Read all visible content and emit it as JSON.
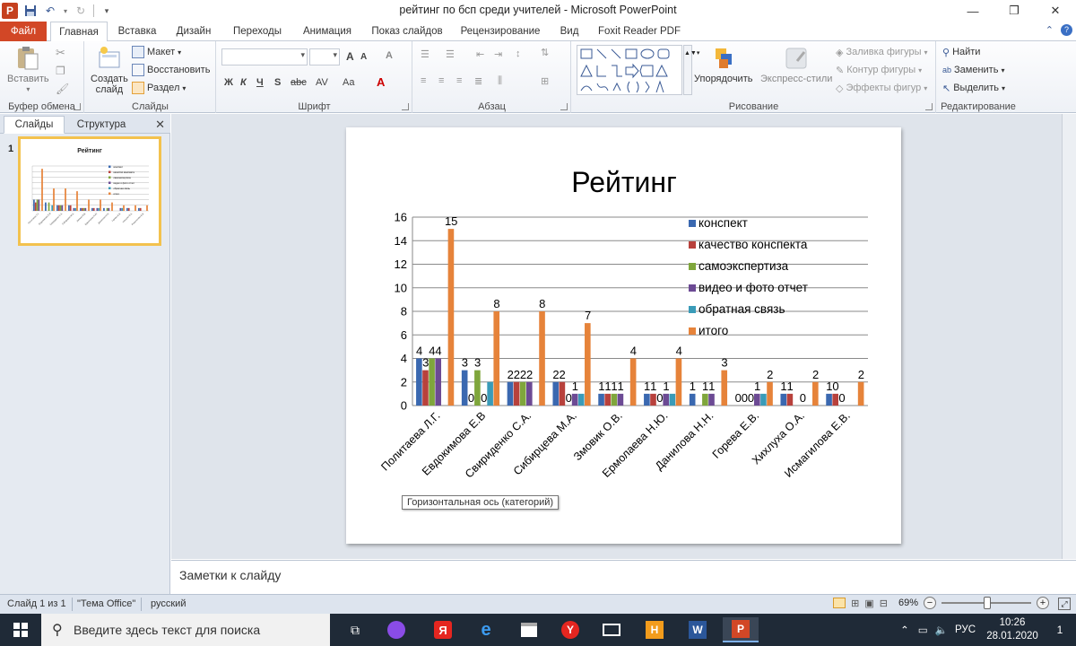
{
  "window": {
    "title": "рейтинг по бсп среди учителей - Microsoft PowerPoint",
    "app_icon": "P",
    "controls": [
      "minimize-icon",
      "restore-icon",
      "close-icon"
    ]
  },
  "ribbon_tabs": {
    "file": "Файл",
    "items": [
      "Главная",
      "Вставка",
      "Дизайн",
      "Переходы",
      "Анимация",
      "Показ слайдов",
      "Рецензирование",
      "Вид",
      "Foxit Reader PDF"
    ],
    "active": "Главная"
  },
  "ribbon": {
    "clipboard": {
      "label": "Буфер обмена",
      "paste": "Вставить"
    },
    "slides": {
      "label": "Слайды",
      "new_slide_1": "Создать",
      "new_slide_2": "слайд",
      "layout": "Макет",
      "reset": "Восстановить",
      "section": "Раздел"
    },
    "font": {
      "label": "Шрифт",
      "bold": "Ж",
      "italic": "К",
      "underline": "Ч",
      "shadow": "S",
      "strike": "abc",
      "spacing": "AV",
      "case": "Aa",
      "grow": "A",
      "shrink": "A",
      "clear": "A"
    },
    "paragraph": {
      "label": "Абзац"
    },
    "drawing": {
      "label": "Рисование",
      "arrange": "Упорядочить",
      "quick_styles": "Экспресс-стили",
      "fill": "Заливка фигуры",
      "outline": "Контур фигуры",
      "effects": "Эффекты фигур"
    },
    "editing": {
      "label": "Редактирование",
      "find": "Найти",
      "replace": "Заменить",
      "select": "Выделить"
    }
  },
  "left_pane": {
    "tab_slides": "Слайды",
    "tab_outline": "Структура",
    "slide_number": "1",
    "thumb_title": "Рейтинг"
  },
  "chart_data": {
    "type": "bar",
    "title": "Рейтинг",
    "xlabel": "",
    "ylabel": "",
    "ylim": [
      0,
      16
    ],
    "yticks": [
      0,
      2,
      4,
      6,
      8,
      10,
      12,
      14,
      16
    ],
    "grid": true,
    "legend_position": "top-right",
    "categories": [
      "Политаева Л.Г.",
      "Евдокимова Е.В",
      "Свириденко С.А.",
      "Сибирцева М.А.",
      "Змовик О.В.",
      "Ермолаева Н.Ю.",
      "Данилова Н.Н.",
      "Горева Е.В.",
      "Хихлуха О.А.",
      "Исмагилова Е.В."
    ],
    "series": [
      {
        "name": "конспект",
        "color": "#3a68b0",
        "values": [
          4,
          3,
          2,
          2,
          1,
          1,
          1,
          0,
          1,
          1
        ]
      },
      {
        "name": "качество конспекта",
        "color": "#b8413c",
        "values": [
          3,
          0,
          2,
          2,
          1,
          1,
          0,
          0,
          1,
          1
        ]
      },
      {
        "name": "самоэкспертиза",
        "color": "#7fa63c",
        "values": [
          4,
          3,
          2,
          0,
          1,
          0,
          1,
          0,
          0,
          0
        ]
      },
      {
        "name": "видео и фото отчет",
        "color": "#6c4a94",
        "values": [
          4,
          0,
          2,
          1,
          1,
          1,
          1,
          1,
          0,
          0
        ]
      },
      {
        "name": "обратная связь",
        "color": "#3a9bb8",
        "values": [
          0,
          2,
          0,
          1,
          0,
          1,
          0,
          1,
          0,
          0
        ]
      },
      {
        "name": "итого",
        "color": "#e6833a",
        "values": [
          15,
          8,
          8,
          7,
          4,
          4,
          3,
          2,
          2,
          2
        ]
      }
    ],
    "data_labels": [
      [
        "4",
        "3",
        "2",
        "2",
        "1",
        "1",
        "1",
        "0",
        "1",
        "1"
      ],
      [
        "3",
        "0",
        "2",
        "2",
        "1",
        "1",
        "",
        "0",
        "1",
        "0"
      ],
      [
        "4",
        "3",
        "2",
        "0",
        "1",
        "0",
        "1",
        "0",
        "",
        "0"
      ],
      [
        "4",
        "0",
        "2",
        "1",
        "1",
        "1",
        "1",
        "1",
        "0",
        ""
      ],
      [
        "",
        "",
        "",
        "",
        "",
        "",
        "",
        "",
        "",
        ""
      ],
      [
        "15",
        "8",
        "8",
        "7",
        "4",
        "4",
        "3",
        "2",
        "2",
        "2"
      ]
    ]
  },
  "tooltip": "Горизонтальная ось (категорий)",
  "notes": {
    "placeholder": "Заметки к слайду"
  },
  "statusbar": {
    "slide": "Слайд 1 из 1",
    "theme": "\"Тема Office\"",
    "language": "русский",
    "zoom": "69%",
    "zoom_level": 0.69
  },
  "taskbar": {
    "search_placeholder": "Введите здесь текст для поиска",
    "lang": "РУС",
    "time": "10:26",
    "date": "28.01.2020",
    "notifications": "1"
  }
}
